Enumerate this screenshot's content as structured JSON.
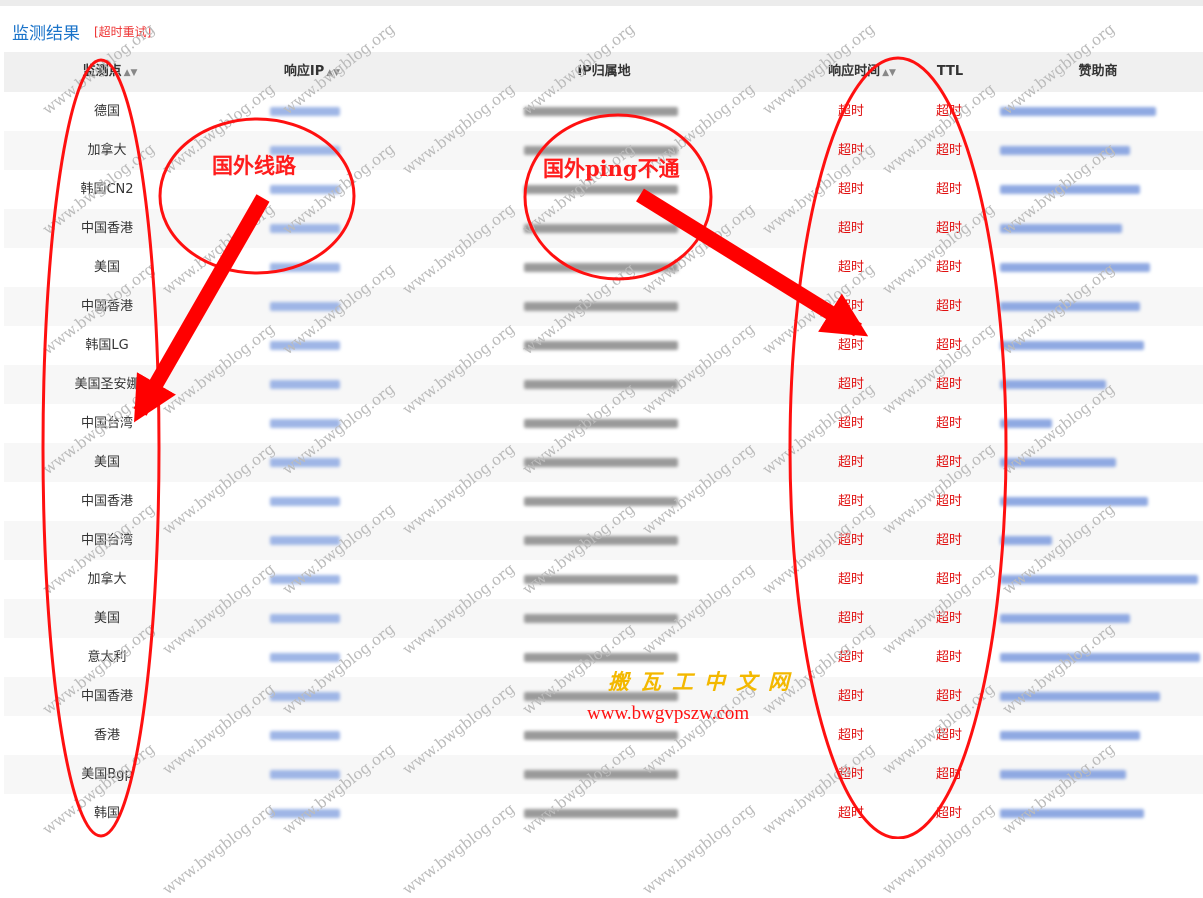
{
  "header": {
    "title": "监测结果",
    "retry_label": "[超时重试]"
  },
  "table": {
    "columns": [
      "监测点",
      "响应IP",
      "IP归属地",
      "响应时间",
      "TTL",
      "赞助商"
    ],
    "rows": [
      {
        "node": "德国",
        "time": "超时",
        "ttl": "超时"
      },
      {
        "node": "加拿大",
        "time": "超时",
        "ttl": "超时"
      },
      {
        "node": "韩国CN2",
        "time": "超时",
        "ttl": "超时"
      },
      {
        "node": "中国香港",
        "time": "超时",
        "ttl": "超时"
      },
      {
        "node": "美国",
        "time": "超时",
        "ttl": "超时"
      },
      {
        "node": "中国香港",
        "time": "超时",
        "ttl": "超时"
      },
      {
        "node": "韩国LG",
        "time": "超时",
        "ttl": "超时"
      },
      {
        "node": "美国圣安娜",
        "time": "超时",
        "ttl": "超时"
      },
      {
        "node": "中国台湾",
        "time": "超时",
        "ttl": "超时"
      },
      {
        "node": "美国",
        "time": "超时",
        "ttl": "超时"
      },
      {
        "node": "中国香港",
        "time": "超时",
        "ttl": "超时"
      },
      {
        "node": "中国台湾",
        "time": "超时",
        "ttl": "超时"
      },
      {
        "node": "加拿大",
        "time": "超时",
        "ttl": "超时"
      },
      {
        "node": "美国",
        "time": "超时",
        "ttl": "超时"
      },
      {
        "node": "意大利",
        "time": "超时",
        "ttl": "超时"
      },
      {
        "node": "中国香港",
        "time": "超时",
        "ttl": "超时"
      },
      {
        "node": "香港",
        "time": "超时",
        "ttl": "超时"
      },
      {
        "node": "美国Bgp",
        "time": "超时",
        "ttl": "超时"
      },
      {
        "node": "韩国",
        "time": "超时",
        "ttl": "超时"
      }
    ]
  },
  "annotations": {
    "left": "国外线路",
    "right": "国外ping不通"
  },
  "watermark": {
    "text": "www.bwgblog.org",
    "brand": "搬瓦工中文网",
    "url": "www.bwgvpszw.com"
  },
  "colors": {
    "accent": "#1a73c9",
    "timeout_red": "#e01010",
    "annotation_red": "#ff1c1c",
    "brand_gold": "#f3b800"
  }
}
